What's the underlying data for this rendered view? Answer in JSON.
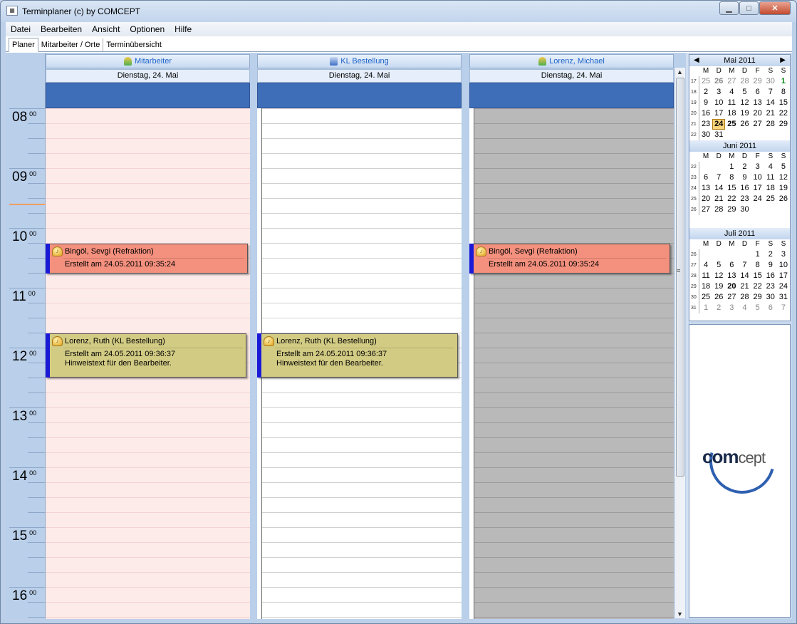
{
  "window": {
    "title": "Terminplaner (c) by COMCEPT",
    "min_label": "▁",
    "max_label": "□",
    "close_label": "✕"
  },
  "menu": [
    "Datei",
    "Bearbeiten",
    "Ansicht",
    "Optionen",
    "Hilfe"
  ],
  "tabs": [
    {
      "label": "Planer",
      "active": true
    },
    {
      "label": "Mitarbeiter / Orte",
      "active": false
    },
    {
      "label": "Terminübersicht",
      "active": false
    }
  ],
  "timeline": {
    "hours": [
      "08",
      "09",
      "10",
      "11",
      "12",
      "13",
      "14",
      "15",
      "16"
    ],
    "minutes": "00"
  },
  "columns": [
    {
      "name": "Mitarbeiter",
      "icon": "user-icon",
      "date": "Dienstag, 24. Mai",
      "background": "#fdebea"
    },
    {
      "name": "KL Bestellung",
      "icon": "resource-icon",
      "date": "Dienstag, 24. Mai",
      "background": "#ffffff"
    },
    {
      "name": "Lorenz, Michael",
      "icon": "user-icon",
      "date": "Dienstag, 24. Mai",
      "background": "#b9b9b9"
    }
  ],
  "appointments": {
    "refraktion": {
      "title": "Bingöl, Sevgi (Refraktion)",
      "line1": "Erstellt am 24.05.2011 09:35:24",
      "color": "#f4907e"
    },
    "bestellung": {
      "title": "Lorenz, Ruth (KL Bestellung)",
      "line1": "Erstellt am 24.05.2011 09:36:37",
      "line2": "Hinweistext für den Bearbeiter.",
      "color": "#d2cb84"
    }
  },
  "calendar": {
    "weekdays": [
      "M",
      "D",
      "M",
      "D",
      "F",
      "S",
      "S"
    ],
    "months": [
      {
        "title": "Mai 2011",
        "weeks": [
          {
            "wk": "17",
            "days": [
              "25",
              "26",
              "27",
              "28",
              "29",
              "30",
              "1"
            ]
          },
          {
            "wk": "18",
            "days": [
              "2",
              "3",
              "4",
              "5",
              "6",
              "7",
              "8"
            ]
          },
          {
            "wk": "19",
            "days": [
              "9",
              "10",
              "11",
              "12",
              "13",
              "14",
              "15"
            ]
          },
          {
            "wk": "20",
            "days": [
              "16",
              "17",
              "18",
              "19",
              "20",
              "21",
              "22"
            ]
          },
          {
            "wk": "21",
            "days": [
              "23",
              "24",
              "25",
              "26",
              "27",
              "28",
              "29"
            ]
          },
          {
            "wk": "22",
            "days": [
              "30",
              "31",
              "",
              "",
              "",
              "",
              ""
            ]
          }
        ]
      },
      {
        "title": "Juni 2011",
        "weeks": [
          {
            "wk": "22",
            "days": [
              "",
              "",
              "1",
              "2",
              "3",
              "4",
              "5"
            ]
          },
          {
            "wk": "23",
            "days": [
              "6",
              "7",
              "8",
              "9",
              "10",
              "11",
              "12"
            ]
          },
          {
            "wk": "24",
            "days": [
              "13",
              "14",
              "15",
              "16",
              "17",
              "18",
              "19"
            ]
          },
          {
            "wk": "25",
            "days": [
              "20",
              "21",
              "22",
              "23",
              "24",
              "25",
              "26"
            ]
          },
          {
            "wk": "26",
            "days": [
              "27",
              "28",
              "29",
              "30",
              "",
              "",
              ""
            ]
          }
        ]
      },
      {
        "title": "Juli 2011",
        "weeks": [
          {
            "wk": "26",
            "days": [
              "",
              "",
              "",
              "",
              "1",
              "2",
              "3"
            ]
          },
          {
            "wk": "27",
            "days": [
              "4",
              "5",
              "6",
              "7",
              "8",
              "9",
              "10"
            ]
          },
          {
            "wk": "28",
            "days": [
              "11",
              "12",
              "13",
              "14",
              "15",
              "16",
              "17"
            ]
          },
          {
            "wk": "29",
            "days": [
              "18",
              "19",
              "20",
              "21",
              "22",
              "23",
              "24"
            ]
          },
          {
            "wk": "30",
            "days": [
              "25",
              "26",
              "27",
              "28",
              "29",
              "30",
              "31"
            ]
          },
          {
            "wk": "31",
            "days": [
              "1",
              "2",
              "3",
              "4",
              "5",
              "6",
              "7"
            ]
          }
        ]
      }
    ],
    "today": "24",
    "prev_icon": "chevron-left-icon",
    "next_icon": "chevron-right-icon"
  },
  "logo": {
    "text_bold": "com",
    "text_light": "cept"
  }
}
